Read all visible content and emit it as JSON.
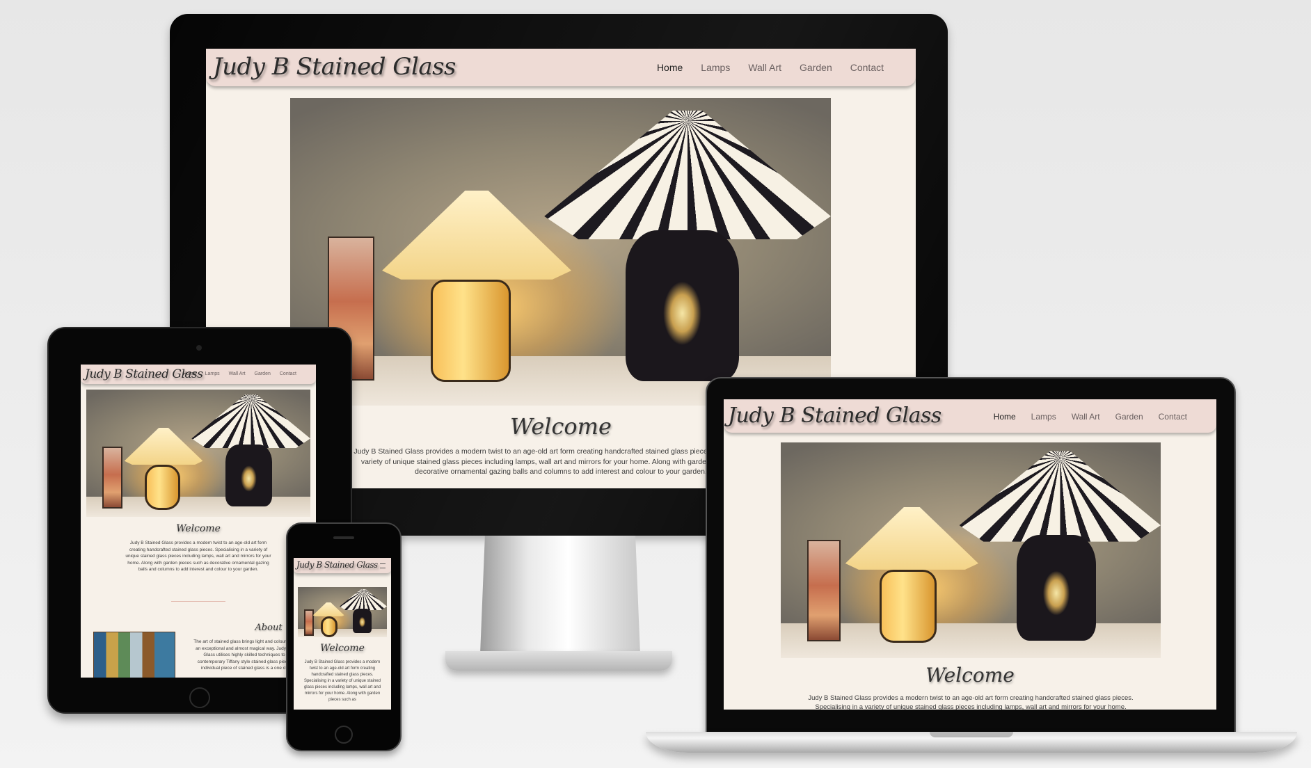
{
  "site": {
    "brand": "Judy B Stained Glass",
    "nav": {
      "home": "Home",
      "lamps": "Lamps",
      "wall_art": "Wall Art",
      "garden": "Garden",
      "contact": "Contact"
    },
    "welcome_heading": "Welcome",
    "intro_desktop": "Judy B Stained Glass provides a modern twist to an age-old art form creating handcrafted stained glass pieces. Specialising in a variety of unique stained glass pieces including lamps, wall art and mirrors for your home. Along with garden pieces such as decorative ornamental gazing balls and columns to add interest and colour to your garden.",
    "intro_tablet": "Judy B Stained Glass provides a modern twist to an age-old art form creating handcrafted stained glass pieces. Specialising in a variety of unique stained glass pieces including lamps, wall art and mirrors for your home. Along with garden pieces such as decorative ornamental gazing balls and columns to add interest and colour to your garden.",
    "intro_phone": "Judy B Stained Glass provides a modern twist to an age-old art form creating handcrafted stained glass pieces. Specialising in a variety of unique stained glass pieces including lamps, wall art and mirrors for your home. Along with garden pieces such as",
    "intro_laptop": "Judy B Stained Glass provides a modern twist to an age-old art form creating handcrafted stained glass pieces. Specialising in a variety of unique stained glass pieces including lamps, wall art and mirrors for your home. Along with",
    "about_heading": "About",
    "about_text": "The art of stained glass brings light and colour together in an exceptional and almost magical way. Judy B Stained Glass utilises highly skilled techniques to create contemporary Tiffany style stained glass pieces. Each individual piece of stained glass is a one of a kind."
  },
  "colors": {
    "nav_bg": "#eedbd5",
    "page_bg": "#f7f1e9",
    "bezel": "#060606"
  }
}
